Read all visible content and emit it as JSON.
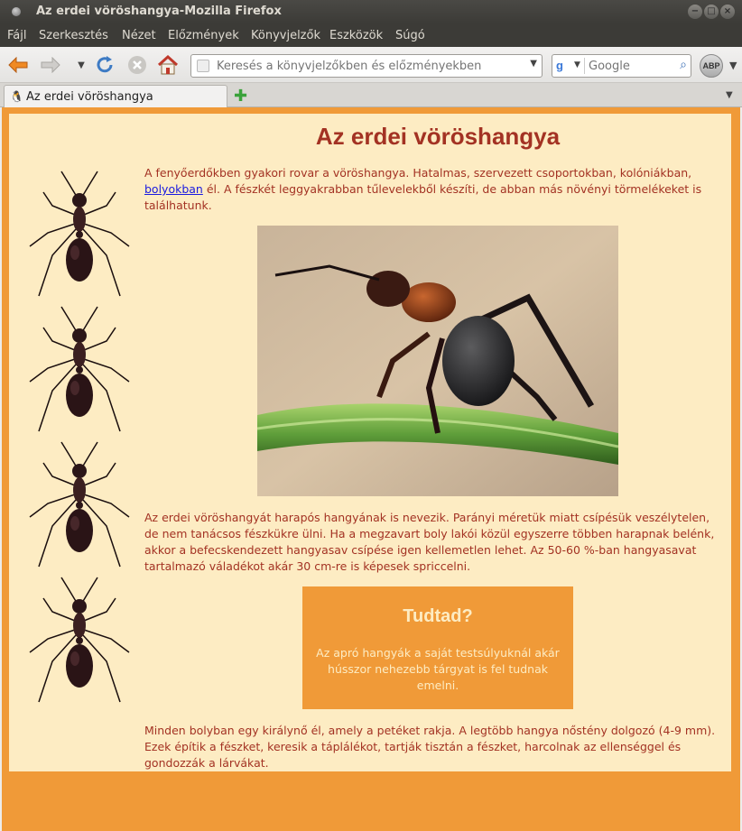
{
  "window": {
    "title": "Az erdei vöröshangya-Mozilla Firefox"
  },
  "menu": [
    "Fájl",
    "Szerkesztés",
    "Nézet",
    "Előzmények",
    "Könyvjelzők",
    "Eszközök",
    "Súgó"
  ],
  "toolbar": {
    "url_placeholder": "Keresés a könyvjelzőkben és előzményekben",
    "search_placeholder": "Google",
    "adblock_label": "ABP"
  },
  "tab": {
    "label": "Az erdei vöröshangya"
  },
  "page": {
    "heading": "Az erdei vöröshangya",
    "p1_before": "A fenyőerdőkben gyakori rovar a vöröshangya. Hatalmas, szervezett csoportokban, kolóniákban, ",
    "p1_link": "bolyokban",
    "p1_after": " él. A fészkét leggyakrabban tűlevelekből készíti, de abban más növényi törmelékeket is találhatunk.",
    "p2": "Az erdei vöröshangyát harapós hangyának is nevezik. Parányi méretük miatt csípésük veszélytelen, de nem tanácsos fészkükre ülni. Ha a megzavart boly lakói közül egyszerre többen harapnak belénk, akkor a befecskendezett hangyasav csípése igen kellemetlen lehet. Az 50-60 %-ban hangyasavat tartalmazó váladékot akár 30 cm-re is képesek spriccelni.",
    "info_title": "Tudtad?",
    "info_body": "Az apró hangyák a saját testsúlyuknál akár hússzor nehezebb tárgyat is fel tudnak emelni.",
    "p3": "Minden bolyban egy királynő él, amely a petéket rakja. A legtöbb hangya nőstény dolgozó (4-9 mm). Ezek építik a fészket, keresik a táplálékot, tartják tisztán a fészket, harcolnak az ellenséggel és gondozzák a lárvákat."
  },
  "colors": {
    "page_bg": "#fdecc3",
    "frame_orange": "#f09a38",
    "text_red": "#a33223",
    "link_blue": "#1a1ae0"
  }
}
